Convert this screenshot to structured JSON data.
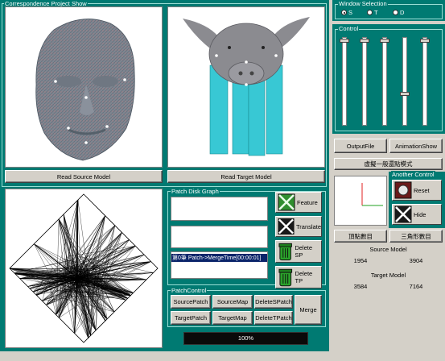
{
  "correspondence": {
    "title": "Correspondence Project Show",
    "read_source_label": "Read Source Model",
    "read_target_label": "Read Target Model"
  },
  "patch_disk": {
    "title": "Patch Disk Graph",
    "log_text": "第0筆 Patch->MergeTime[00:00:01]",
    "feature_label": "Feature",
    "translate_label": "Translate",
    "delete_sp_label": "Delete SP",
    "delete_tp_label": "Delete TP"
  },
  "patch_control": {
    "title": "PatchControl",
    "source_patch": "SourcePatch",
    "source_map": "SourceMap",
    "delete_s_patch": "DeleteSPatch",
    "target_patch": "TargetPatch",
    "target_map": "TargetMap",
    "delete_t_patch": "DeleteTPatch",
    "merge": "Merge"
  },
  "progress": {
    "text": "100%",
    "value": 100
  },
  "window_selection": {
    "title": "Window Selection",
    "options": [
      {
        "label": "S",
        "selected": true
      },
      {
        "label": "T",
        "selected": false
      },
      {
        "label": "D",
        "selected": false
      }
    ]
  },
  "control": {
    "title": "Control",
    "sliders": [
      0.0,
      0.0,
      0.0,
      0.65,
      0.0
    ]
  },
  "buttons": {
    "output_file": "OutputFile",
    "animation_show": "AnimationShow",
    "virtual_mode": "虛擬一般還點模式"
  },
  "another_control": {
    "title": "Another Control",
    "reset": "Reset",
    "hide": "Hide"
  },
  "counts": {
    "vertex_label": "頂點數目",
    "triangle_label": "三角形數目",
    "source_model_label": "Source Model",
    "source_vertices": "1954",
    "source_triangles": "3904",
    "target_model_label": "Target Model",
    "target_vertices": "3584",
    "target_triangles": "7164"
  },
  "colors": {
    "panel_teal": "#007a72",
    "face_gray": "#8a8f9a",
    "pig_gray": "#8b8b90",
    "pig_legs": "#38c8d4",
    "progress_fill": "#0a0a0a"
  }
}
